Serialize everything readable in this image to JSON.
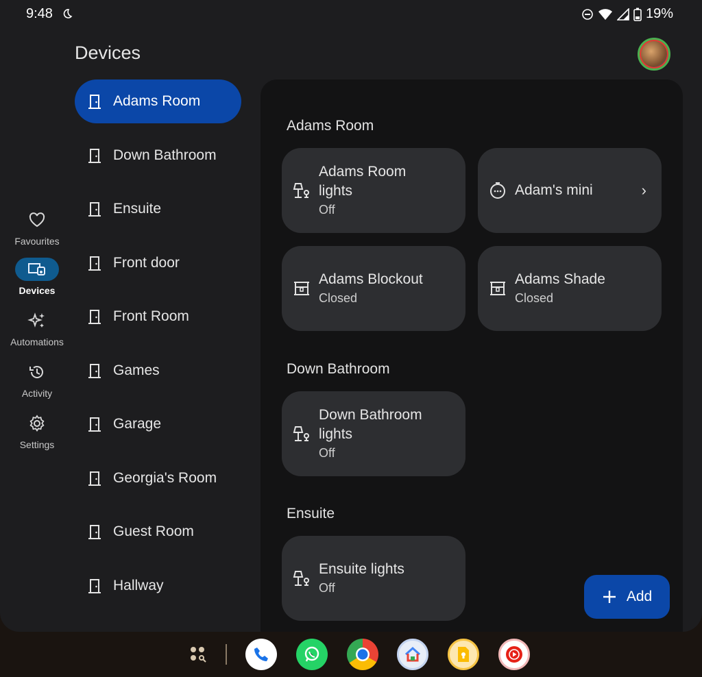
{
  "status": {
    "time": "9:48",
    "battery": "19%"
  },
  "page": {
    "title": "Devices"
  },
  "rail": [
    {
      "label": "Favourites",
      "icon": "heart-icon"
    },
    {
      "label": "Devices",
      "icon": "devices-icon"
    },
    {
      "label": "Automations",
      "icon": "sparkle-icon"
    },
    {
      "label": "Activity",
      "icon": "history-icon"
    },
    {
      "label": "Settings",
      "icon": "gear-icon"
    }
  ],
  "rooms": [
    "Adams Room",
    "Down Bathroom",
    "Ensuite",
    "Front door",
    "Front Room",
    "Games",
    "Garage",
    "Georgia's Room",
    "Guest Room",
    "Hallway"
  ],
  "sections": {
    "adams": {
      "title": "Adams Room",
      "cards": [
        {
          "title_line1": "Adams Room",
          "title_line2": "lights",
          "status": "Off",
          "icon": "lamp-icon"
        },
        {
          "title": "Adam's mini",
          "icon": "speaker-icon"
        },
        {
          "title": "Adams Blockout",
          "status": "Closed",
          "icon": "blind-icon"
        },
        {
          "title": "Adams Shade",
          "status": "Closed",
          "icon": "blind-icon"
        }
      ]
    },
    "down": {
      "title": "Down Bathroom",
      "cards": [
        {
          "title_line1": "Down Bathroom",
          "title_line2": "lights",
          "status": "Off",
          "icon": "lamp-icon"
        }
      ]
    },
    "ensuite": {
      "title": "Ensuite",
      "cards": [
        {
          "title": "Ensuite lights",
          "status": "Off",
          "icon": "lamp-icon"
        }
      ]
    }
  },
  "fab": {
    "label": "Add"
  },
  "colors": {
    "accent": "#0b47a8",
    "rail_active": "#0f5b8f",
    "card": "#2d2e31",
    "panel": "#131314"
  }
}
